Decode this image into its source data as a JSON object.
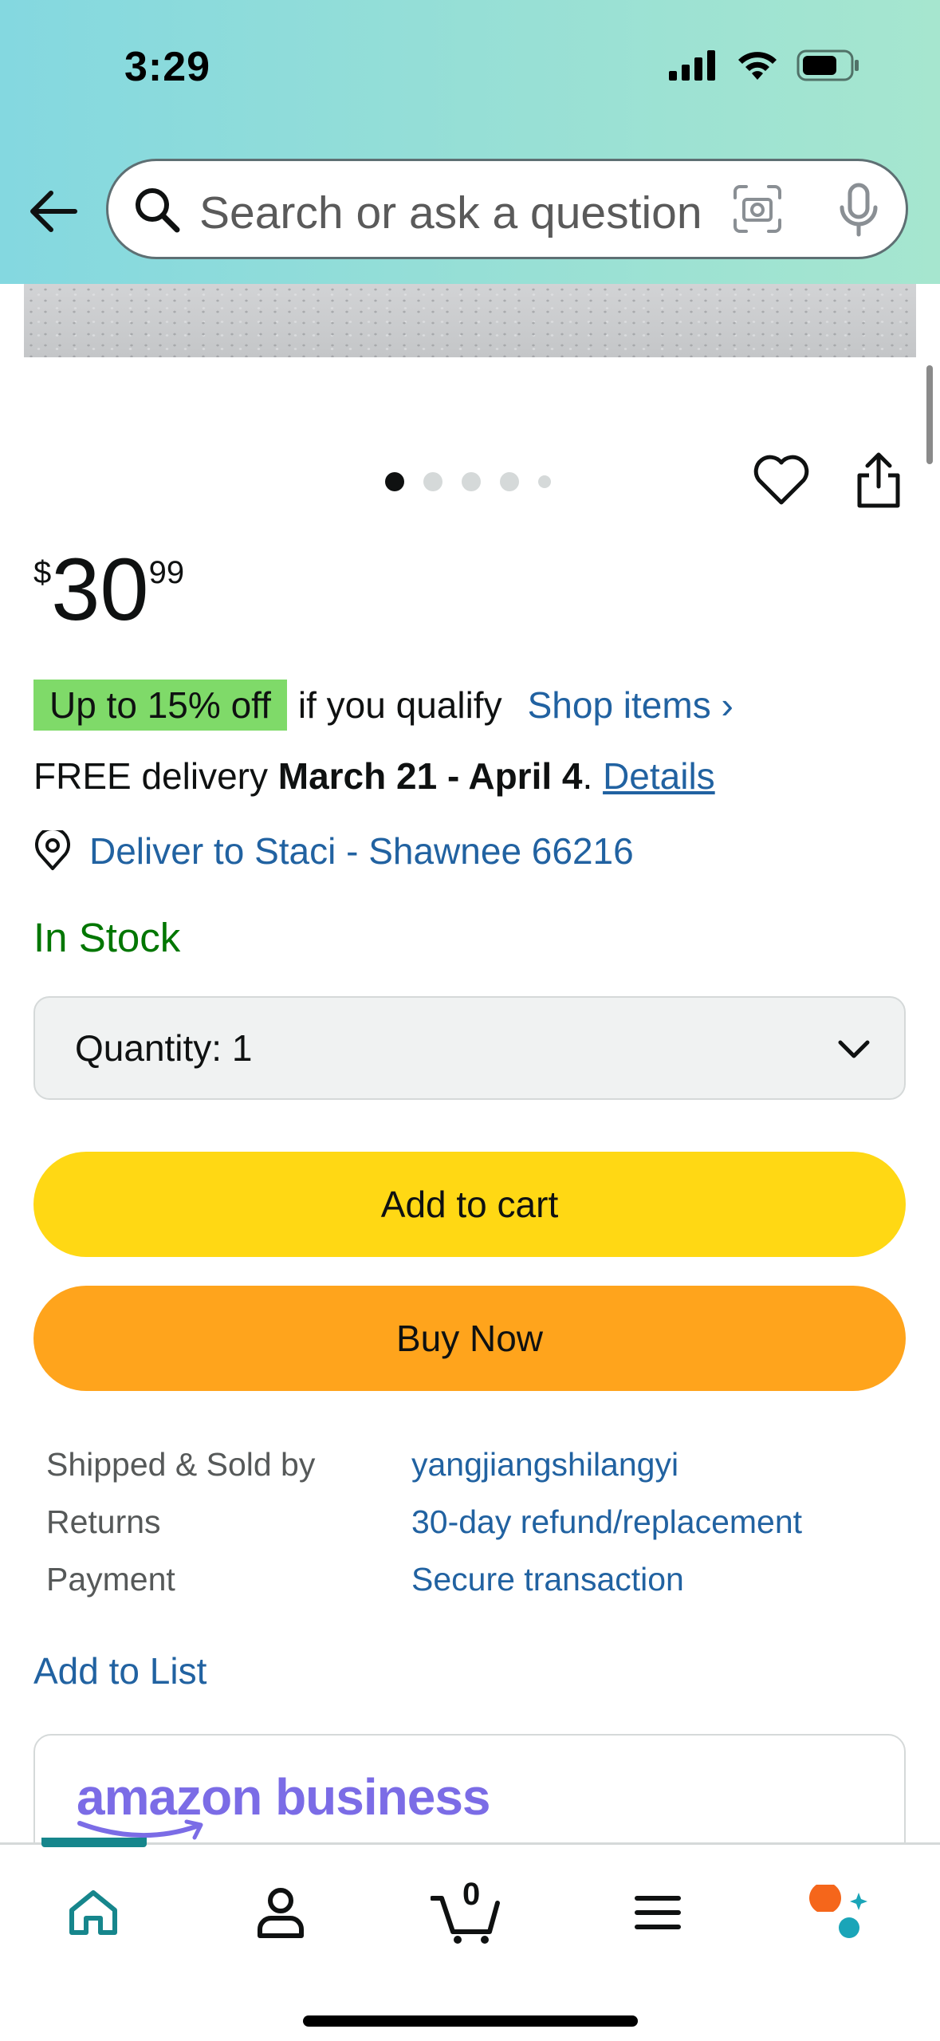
{
  "status_bar": {
    "time": "3:29"
  },
  "search": {
    "placeholder": "Search or ask a question"
  },
  "image_carousel": {
    "count": 5,
    "active_index": 0
  },
  "price": {
    "symbol": "$",
    "whole": "30",
    "fraction": "99"
  },
  "promo": {
    "badge": "Up to 15% off",
    "text": "if you qualify",
    "link": "Shop items ›"
  },
  "delivery": {
    "prefix": "FREE delivery ",
    "dates": "March 21 - April 4",
    "suffix": ". ",
    "details_link": "Details"
  },
  "deliver_to": "Deliver to Staci - Shawnee 66216",
  "stock_status": "In Stock",
  "quantity": {
    "label": "Quantity:",
    "value": "1"
  },
  "buttons": {
    "add_to_cart": "Add to cart",
    "buy_now": "Buy Now"
  },
  "seller_info": [
    {
      "label": "Shipped & Sold by",
      "value": "yangjiangshilangyi"
    },
    {
      "label": "Returns",
      "value": "30-day refund/replacement"
    },
    {
      "label": "Payment",
      "value": "Secure transaction"
    }
  ],
  "add_to_list": "Add to List",
  "business_card": {
    "logo_text": "amazon business"
  },
  "bottom_nav": {
    "items": [
      {
        "name": "home",
        "icon": "home-icon"
      },
      {
        "name": "account",
        "icon": "person-icon"
      },
      {
        "name": "cart",
        "icon": "cart-icon",
        "badge": "0"
      },
      {
        "name": "menu",
        "icon": "menu-icon"
      },
      {
        "name": "rufus",
        "icon": "rufus-icon"
      }
    ]
  },
  "colors": {
    "link": "#2162a1",
    "add_to_cart": "#ffd814",
    "buy_now": "#ffa41c",
    "in_stock": "#007600",
    "promo_badge": "#7fda69"
  }
}
